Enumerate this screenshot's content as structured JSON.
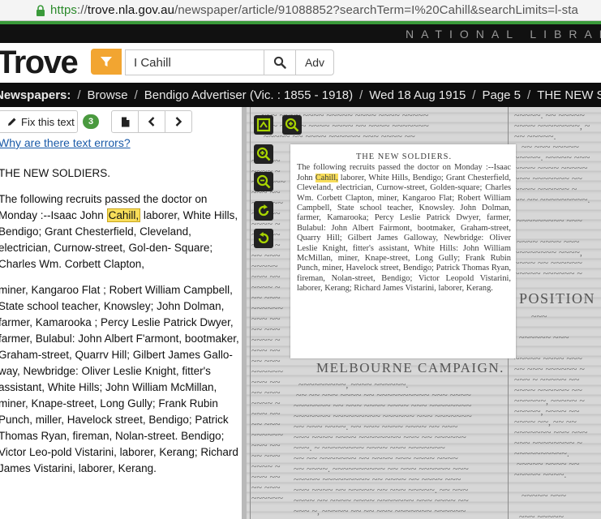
{
  "browser": {
    "url_scheme": "https",
    "url_sep": "://",
    "url_host": "trove.nla.gov.au",
    "url_path": "/newspaper/article/91088852?searchTerm=I%20Cahill&searchLimits=l-sta"
  },
  "banner": {
    "text": "NATIONAL LIBRARY"
  },
  "header": {
    "logo": "Trove",
    "search_value": "I Cahill",
    "adv_label": "Adv"
  },
  "breadcrumb": {
    "items": [
      "Newspapers:",
      "Browse",
      "Bendigo Advertiser (Vic. : 1855 - 1918)",
      "Wed 18 Aug 1915",
      "Page 5",
      "THE NEW SOLDIERS."
    ],
    "separator": "/"
  },
  "toolbar": {
    "fix_label": "Fix this text",
    "corrections_count": "3",
    "error_link": "Why are there text errors?"
  },
  "article": {
    "title": "THE NEW SOLDIERS.",
    "p1_before": "The following recruits passed the doctor on Monday :--Isaac John ",
    "p1_highlight": "Cahill,",
    "p1_after": " laborer, White Hills, Bendigo; Grant Chesterfield, Cleveland, electrician, Curnow-street, Gol-den- Square; Charles Wm. Corbett Clapton,",
    "p2": "miner, Kangaroo Flat ; Robert William Campbell, State school teacher, Knowsley; John Dolman, farmer, Kamarooka ; Percy Leslie Patrick Dwyer, farmer, Bulabul: John Albert F'armont, bootmaker, Graham-street, Quarrv Hill; Gilbert James Gallo-way, Newbridge: Oliver Leslie Knight, fitter's assistant, White Hills; John William McMillan, miner, Knape-street, Long Gully; Frank Rubin Punch, miller, Havelock street, Bendigo; Patrick Thomas Ryan, fireman, Nolan-street. Bendigo; Victor Leo-pold Vistarini, laborer, Kerang; Richard James Vistarini, laborer, Kerang."
  },
  "scan": {
    "clip_title": "THE NEW SOLDIERS.",
    "clip_before": "The following recruits passed the doctor on Monday :--Isaac John ",
    "clip_highlight": "Cahill,",
    "clip_after": " laborer, White Hills, Bendigo; Grant Chesterfield, Cleveland, electrician, Curnow-street, Golden-square; Charles Wm. Corbett Clapton, miner, Kangaroo Flat; Robert William Campbell, State school teacher, Knowsley. John Dolman, farmer, Kamarooka; Percy Leslie Patrick Dwyer, farmer, Bulabul: John Albert Fairmont, bootmaker, Graham-street, Quarry Hill; Gilbert James Galloway, Newbridge: Oliver Leslie Knight, fitter's assistant, White Hills: John William McMillan, miner, Knape-street, Long Gully; Frank Rubin Punch, miner, Havelock street, Bendigo; Patrick Thomas Ryan, fireman, Nolan-street, Bendigo; Victor Leopold Vistarini, laborer, Kerang; Richard James Vistarini, laborer, Kerang.",
    "heading_melbourne": "MELBOURNE CAMPAIGN.",
    "heading_position": "POSITION",
    "colors": {
      "highlight": "#f8de5a",
      "viewer_button_icon": "#a8d400"
    }
  }
}
